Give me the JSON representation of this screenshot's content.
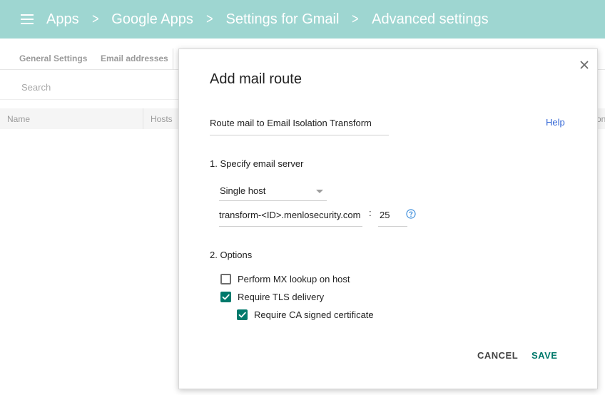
{
  "header": {
    "menu_icon": "hamburger-menu-icon",
    "breadcrumbs": [
      "Apps",
      "Google Apps",
      "Settings for Gmail",
      "Advanced settings"
    ],
    "separator": ">"
  },
  "background": {
    "tabs": [
      "General Settings",
      "Email addresses"
    ],
    "search_placeholder": "Search",
    "columns": [
      "Name",
      "Hosts"
    ],
    "columns_right_fragment": "on"
  },
  "dialog": {
    "title": "Add mail route",
    "route_name": "Route mail to Email Isolation Transform",
    "help_label": "Help",
    "section1_label": "1. Specify email server",
    "server_type": "Single host",
    "host_value": "transform-<ID>.menlosecurity.com",
    "colon": ":",
    "port_value": "25",
    "help_icon": "question-circle-icon",
    "section2_label": "2. Options",
    "options": [
      {
        "label": "Perform MX lookup on host",
        "checked": false
      },
      {
        "label": "Require TLS delivery",
        "checked": true
      },
      {
        "label": "Require CA signed certificate",
        "checked": true
      }
    ],
    "cancel_label": "CANCEL",
    "save_label": "SAVE",
    "close_icon": "close-icon"
  },
  "colors": {
    "appbar": "#9ed6d1",
    "accent": "#00796b",
    "link": "#3367d6"
  }
}
